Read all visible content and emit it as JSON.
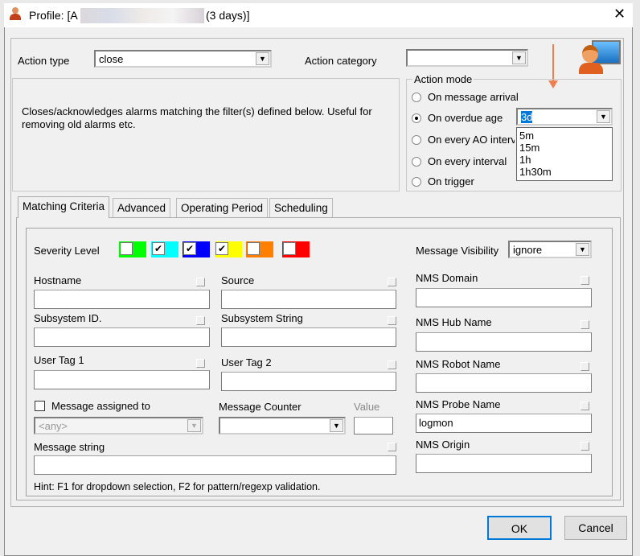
{
  "window": {
    "title_prefix": "Profile: [A",
    "title_suffix": "(3 days)]",
    "close": "✕"
  },
  "action_type": {
    "label": "Action type",
    "value": "close"
  },
  "action_category": {
    "label": "Action category",
    "value": ""
  },
  "description": "Closes/acknowledges alarms matching the filter(s) defined below.  Useful for removing old alarms etc.",
  "action_mode": {
    "label": "Action mode",
    "options": [
      "On message arrival",
      "On overdue age",
      "On every AO interval",
      "On every interval",
      "On trigger"
    ],
    "selected": 1,
    "age_value": "3d",
    "age_options": [
      "5m",
      "15m",
      "1h",
      "1h30m"
    ]
  },
  "tabs": [
    "Matching Criteria",
    "Advanced",
    "Operating Period",
    "Scheduling"
  ],
  "severity": {
    "label": "Severity Level",
    "levels": [
      {
        "color": "#00ff00",
        "checked": false
      },
      {
        "color": "#00ffff",
        "checked": true
      },
      {
        "color": "#0000ff",
        "checked": true
      },
      {
        "color": "#ffff00",
        "checked": true
      },
      {
        "color": "#ff8000",
        "checked": false
      },
      {
        "color": "#ff0000",
        "checked": false
      }
    ]
  },
  "message_visibility": {
    "label": "Message Visibility",
    "value": "ignore"
  },
  "fields": {
    "hostname": "Hostname",
    "source": "Source",
    "subsystem_id": "Subsystem ID.",
    "subsystem_string": "Subsystem String",
    "user_tag1": "User Tag 1",
    "user_tag2": "User Tag 2",
    "message_string": "Message string",
    "nms_domain": "NMS Domain",
    "nms_hub": "NMS Hub Name",
    "nms_robot": "NMS Robot Name",
    "nms_probe": "NMS Probe Name",
    "nms_probe_value": "logmon",
    "nms_origin": "NMS Origin"
  },
  "assigned": {
    "label": "Message assigned to",
    "value": "<any>"
  },
  "counter": {
    "label": "Message Counter",
    "value_label": "Value"
  },
  "hint": "Hint: F1 for dropdown selection, F2 for pattern/regexp validation.",
  "buttons": {
    "ok": "OK",
    "cancel": "Cancel"
  }
}
